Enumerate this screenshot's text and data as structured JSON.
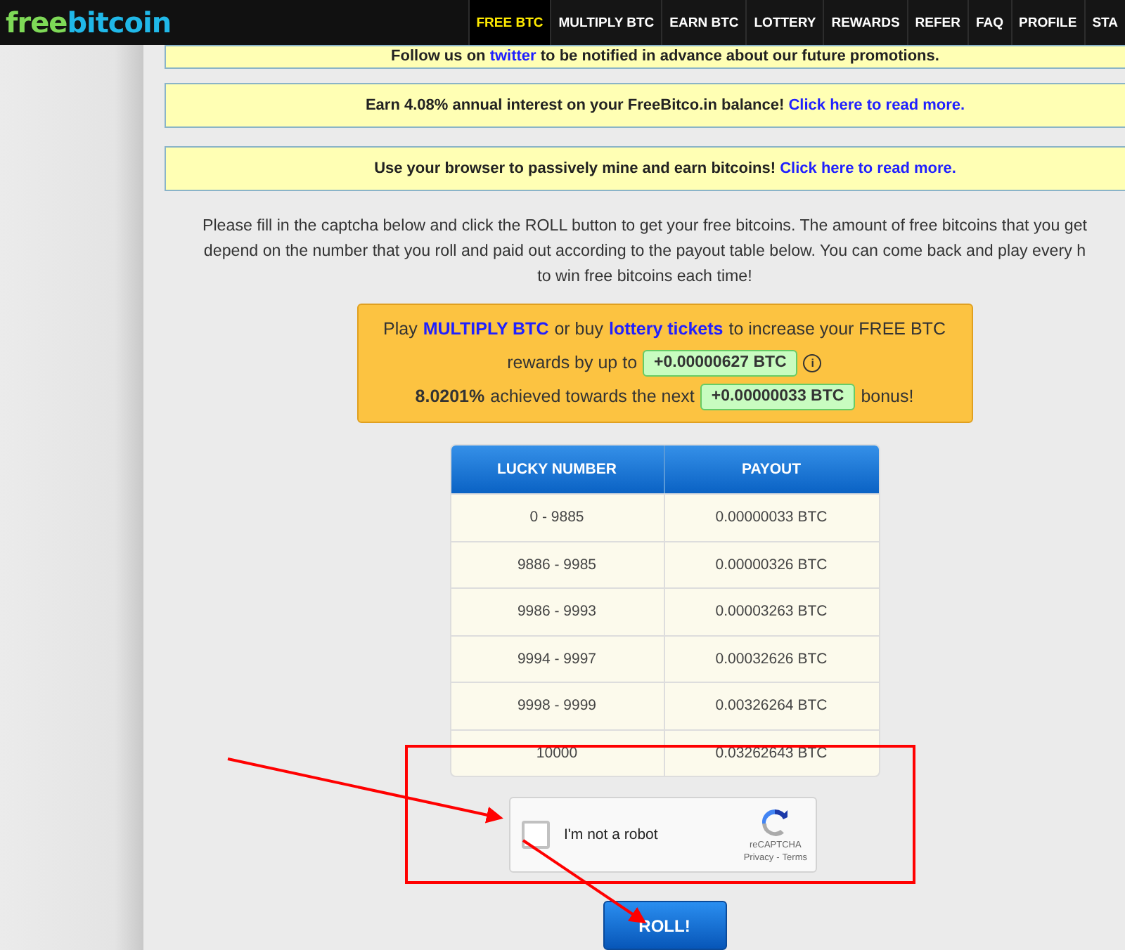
{
  "header": {
    "logo_left": "free",
    "logo_right": "bitcoin",
    "nav": [
      {
        "label": "FREE BTC",
        "selected": true
      },
      {
        "label": "MULTIPLY BTC",
        "selected": false
      },
      {
        "label": "EARN BTC",
        "selected": false
      },
      {
        "label": "LOTTERY",
        "selected": false
      },
      {
        "label": "REWARDS",
        "selected": false
      },
      {
        "label": "REFER",
        "selected": false
      },
      {
        "label": "FAQ",
        "selected": false
      },
      {
        "label": "PROFILE",
        "selected": false
      },
      {
        "label": "STA",
        "selected": false
      }
    ]
  },
  "notices": [
    {
      "text": "Follow us on",
      "link": "twitter",
      "after": "to be notified in advance about our future promotions."
    },
    {
      "text": "Earn 4.08% annual interest on your FreeBitco.in balance!",
      "link": "Click here to read more."
    },
    {
      "text": "Use your browser to passively mine and earn bitcoins!",
      "link": "Click here to read more."
    }
  ],
  "intro_lines": [
    "Please fill in the captcha below and click the ROLL button to get your free bitcoins. The amount of free bitcoins that you get",
    "depend on the number that you roll and paid out according to the payout table below. You can come back and play every h",
    "to win free bitcoins each time!"
  ],
  "bonus": {
    "play": "Play",
    "multiply_link": "MULTIPLY BTC",
    "or_buy": "or buy",
    "lottery_link": "lottery tickets",
    "increase": "to increase your FREE BTC",
    "rewards_by": "rewards by up to",
    "reward_amount": "+0.00000627 BTC",
    "info": "i",
    "percent": "8.0201%",
    "achieved": "achieved towards the next",
    "next_amount": "+0.00000033 BTC",
    "bonus_word": "bonus!"
  },
  "payout_table": {
    "columns": [
      "LUCKY NUMBER",
      "PAYOUT"
    ],
    "rows": [
      [
        "0 - 9885",
        "0.00000033 BTC"
      ],
      [
        "9886 - 9985",
        "0.00000326 BTC"
      ],
      [
        "9986 - 9993",
        "0.00003263 BTC"
      ],
      [
        "9994 - 9997",
        "0.00032626 BTC"
      ],
      [
        "9998 - 9999",
        "0.00326264 BTC"
      ],
      [
        "10000",
        "0.03262643 BTC"
      ]
    ]
  },
  "captcha": {
    "label": "I'm not a robot",
    "checked": false,
    "brand": "reCAPTCHA",
    "privacy": "Privacy",
    "sep": "-",
    "terms": "Terms"
  },
  "roll_button": "ROLL!"
}
